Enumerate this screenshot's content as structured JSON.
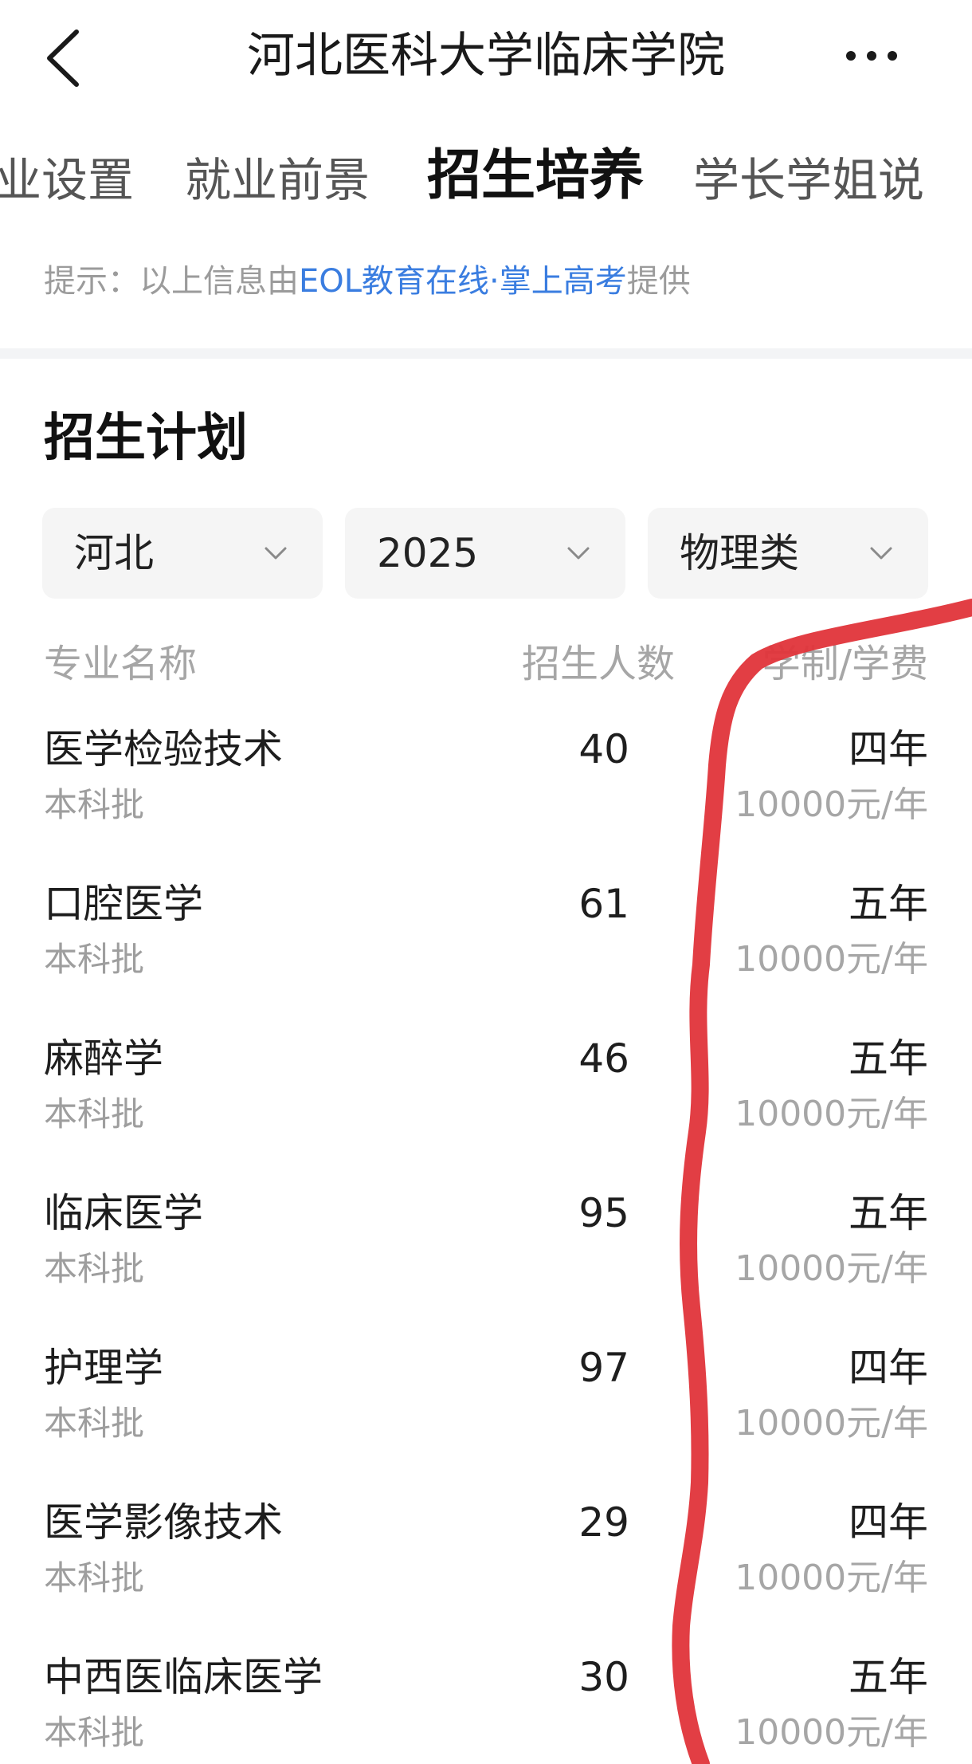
{
  "header": {
    "title": "河北医科大学临床学院",
    "back_icon": "chevron-left-icon",
    "more_icon": "more-horizontal-icon"
  },
  "tabs": [
    {
      "label": "业设置",
      "active": false
    },
    {
      "label": "就业前景",
      "active": false
    },
    {
      "label": "招生培养",
      "active": true
    },
    {
      "label": "学长学姐说",
      "active": false
    }
  ],
  "hint": {
    "prefix": "提示：以上信息由",
    "link": "EOL教育在线·掌上高考",
    "suffix": "提供"
  },
  "section": {
    "title": "招生计划"
  },
  "filters": {
    "province": "河北",
    "year": "2025",
    "subject": "物理类"
  },
  "table": {
    "headers": {
      "name": "专业名称",
      "count": "招生人数",
      "duration_fee": "学制/学费"
    },
    "rows": [
      {
        "name": "医学检验技术",
        "batch": "本科批",
        "count": "40",
        "duration": "四年",
        "fee": "10000元/年"
      },
      {
        "name": "口腔医学",
        "batch": "本科批",
        "count": "61",
        "duration": "五年",
        "fee": "10000元/年"
      },
      {
        "name": "麻醉学",
        "batch": "本科批",
        "count": "46",
        "duration": "五年",
        "fee": "10000元/年"
      },
      {
        "name": "临床医学",
        "batch": "本科批",
        "count": "95",
        "duration": "五年",
        "fee": "10000元/年"
      },
      {
        "name": "护理学",
        "batch": "本科批",
        "count": "97",
        "duration": "四年",
        "fee": "10000元/年"
      },
      {
        "name": "医学影像技术",
        "batch": "本科批",
        "count": "29",
        "duration": "四年",
        "fee": "10000元/年"
      },
      {
        "name": "中西医临床医学",
        "batch": "本科批",
        "count": "30",
        "duration": "五年",
        "fee": "10000元/年"
      }
    ]
  },
  "colors": {
    "accent_link": "#3a7de0",
    "annotation_red": "#e0343a"
  }
}
